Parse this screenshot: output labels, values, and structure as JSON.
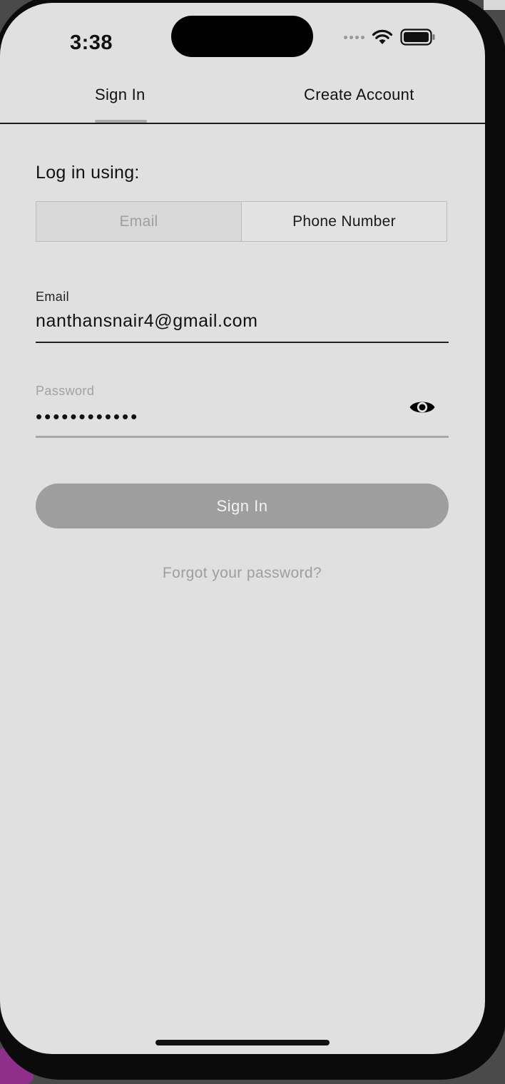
{
  "status_bar": {
    "time": "3:38"
  },
  "tabs": [
    {
      "label": "Sign In",
      "selected": true
    },
    {
      "label": "Create Account",
      "selected": false
    }
  ],
  "form": {
    "login_using_label": "Log in using:",
    "methods": [
      {
        "label": "Email",
        "selected": true
      },
      {
        "label": "Phone Number",
        "selected": false
      }
    ],
    "email": {
      "label": "Email",
      "value": "nanthansnair4@gmail.com"
    },
    "password": {
      "label": "Password",
      "value": "••••••••••••",
      "toggle_icon": "eye-icon"
    },
    "submit_label": "Sign In",
    "forgot_label": "Forgot your password?"
  },
  "colors": {
    "background": "#e0e0e0",
    "button_disabled": "#9e9e9e",
    "muted_text": "#9e9e9e",
    "text": "#111111"
  }
}
